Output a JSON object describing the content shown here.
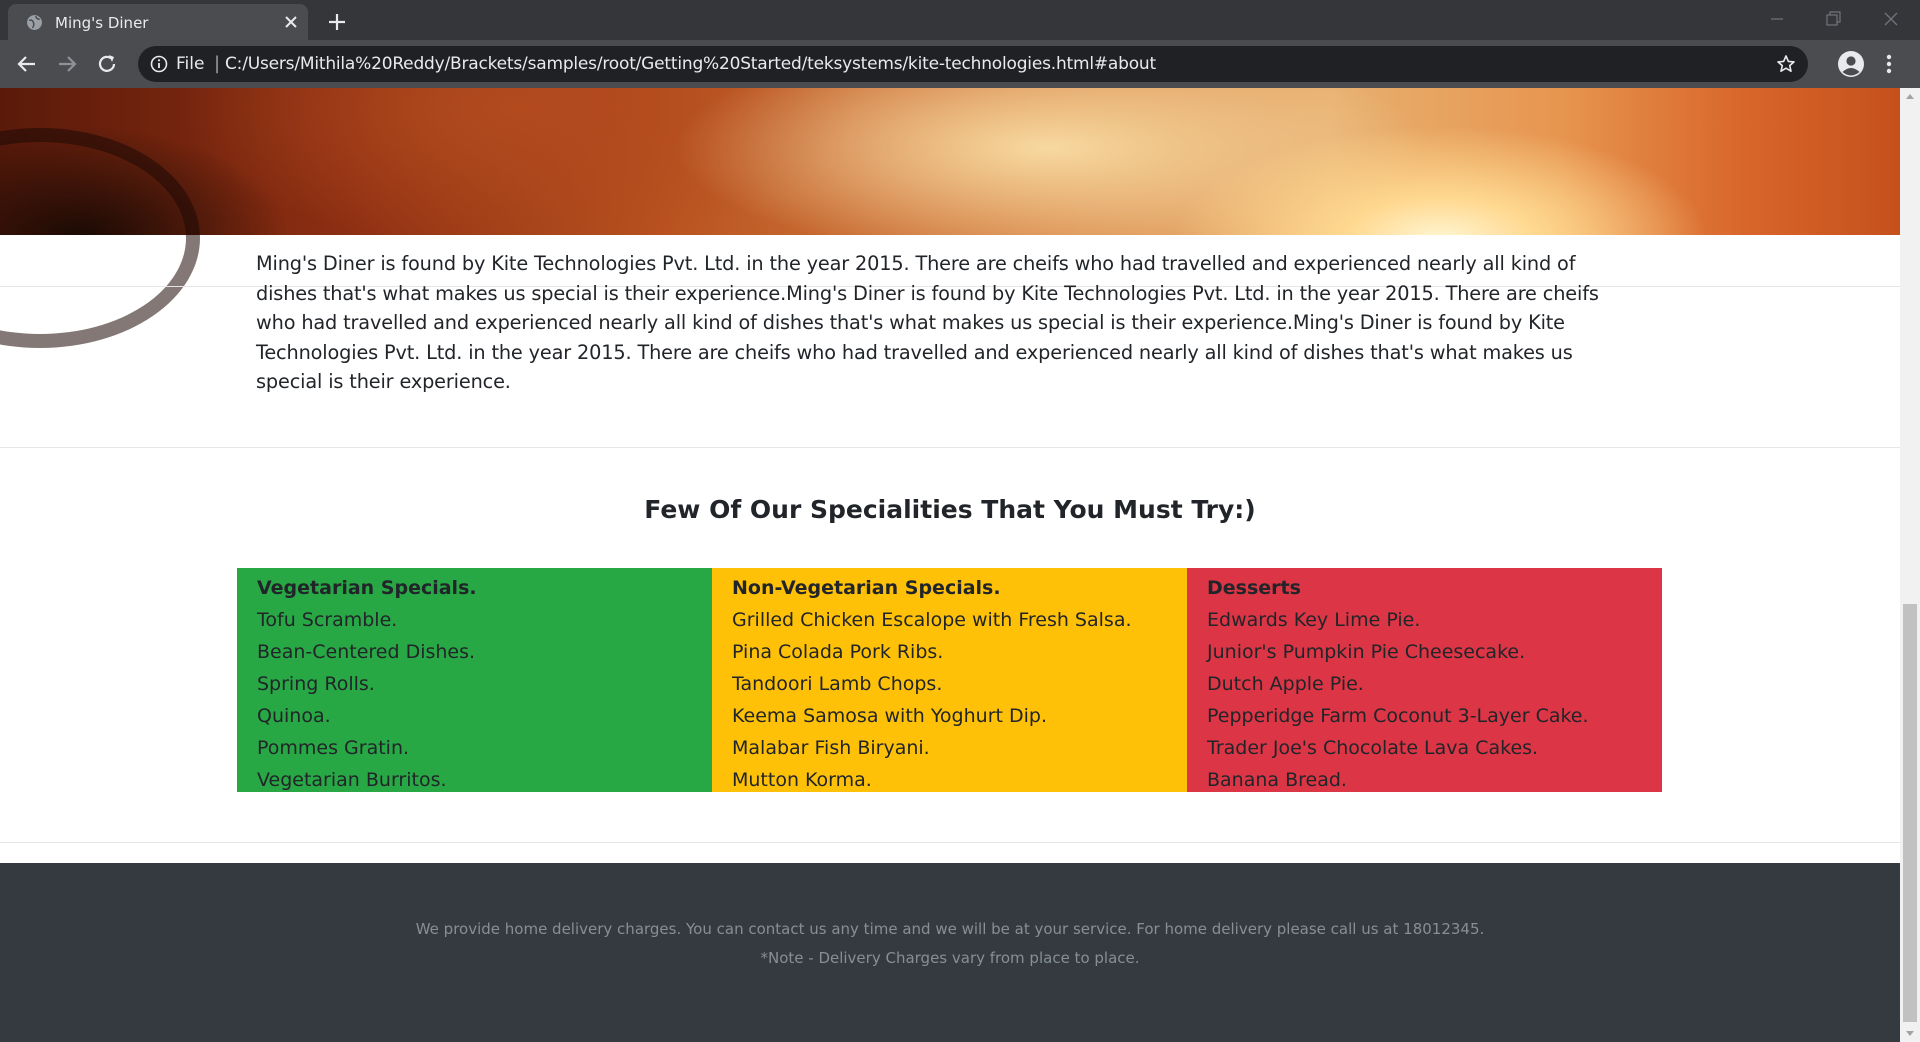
{
  "browser": {
    "tab_title": "Ming's Diner",
    "url_scheme": "File",
    "url_separator": "|",
    "url": "C:/Users/Mithila%20Reddy/Brackets/samples/root/Getting%20Started/teksystems/kite-technologies.html#about"
  },
  "about": {
    "text": "Ming's Diner is found by Kite Technologies Pvt. Ltd. in the year 2015. There are cheifs who had travelled and experienced nearly all kind of dishes that's what makes us special is their experience.Ming's Diner is found by Kite Technologies Pvt. Ltd. in the year 2015. There are cheifs who had travelled and experienced nearly all kind of dishes that's what makes us special is their experience.Ming's Diner is found by Kite Technologies Pvt. Ltd. in the year 2015. There are cheifs who had travelled and experienced nearly all kind of dishes that's what makes us special is their experience."
  },
  "specialities": {
    "title": "Few Of Our Specialities That You Must Try:)",
    "columns": [
      {
        "heading": "Vegetarian Specials.",
        "color": "#28a745",
        "items": [
          "Tofu Scramble.",
          "Bean-Centered Dishes.",
          "Spring Rolls.",
          "Quinoa.",
          "Pommes Gratin.",
          "Vegetarian Burritos."
        ]
      },
      {
        "heading": "Non-Vegetarian Specials.",
        "color": "#ffc107",
        "items": [
          "Grilled Chicken Escalope with Fresh Salsa.",
          "Pina Colada Pork Ribs.",
          "Tandoori Lamb Chops.",
          "Keema Samosa with Yoghurt Dip.",
          "Malabar Fish Biryani.",
          "Mutton Korma."
        ]
      },
      {
        "heading": "Desserts",
        "color": "#dc3545",
        "items": [
          "Edwards Key Lime Pie.",
          "Junior's Pumpkin Pie Cheesecake.",
          "Dutch Apple Pie.",
          "Pepperidge Farm Coconut 3-Layer Cake.",
          "Trader Joe's Chocolate Lava Cakes.",
          "Banana Bread."
        ]
      }
    ]
  },
  "footer": {
    "line1": "We provide home delivery charges. You can contact us any time and we will be at your service. For home delivery please call us at 18012345.",
    "line2": "*Note - Delivery Charges vary from place to place."
  }
}
